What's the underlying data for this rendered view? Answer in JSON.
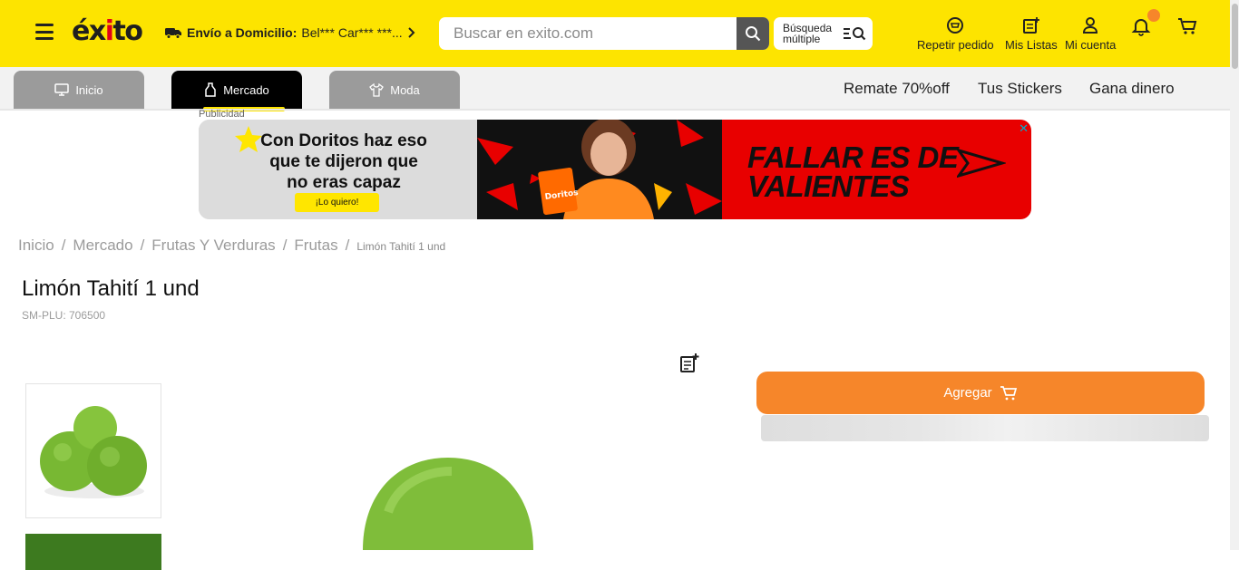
{
  "header": {
    "logo": "éxito",
    "delivery_label": "Envío a Domicilio:",
    "delivery_value": "Bel*** Car*** ***...",
    "search_placeholder": "Buscar en exito.com",
    "multi_search_line1": "Búsqueda",
    "multi_search_line2": "múltiple",
    "repeat_order": "Repetir pedido",
    "my_lists": "Mis Listas",
    "my_account": "Mi cuenta"
  },
  "nav": {
    "tabs": [
      {
        "label": "Inicio",
        "icon": "monitor-icon"
      },
      {
        "label": "Mercado",
        "icon": "bottle-icon"
      },
      {
        "label": "Moda",
        "icon": "shirt-icon"
      }
    ],
    "links": [
      "Remate 70%off",
      "Tus Stickers",
      "Gana dinero"
    ]
  },
  "ad": {
    "label": "Publicidad",
    "copy_line1": "Con Doritos haz eso",
    "copy_line2": "que te dijeron que",
    "copy_line3": "no eras capaz",
    "cta": "¡Lo quiero!",
    "slogan_line1": "FALLAR ES DE",
    "slogan_line2": "VALIENTES",
    "close": "✕",
    "brand_bag": "Doritos"
  },
  "breadcrumb": [
    "Inicio",
    "Mercado",
    "Frutas Y Verduras",
    "Frutas",
    "Limón Tahití 1 und"
  ],
  "product": {
    "title": "Limón Tahití 1 und",
    "plu": "SM-PLU: 706500",
    "add_button": "Agregar"
  },
  "colors": {
    "header_bg": "#fde400",
    "accent_orange": "#f6862a",
    "tab_active": "#000000",
    "tab_inactive": "#9b9b9b",
    "ad_red": "#e80000"
  }
}
